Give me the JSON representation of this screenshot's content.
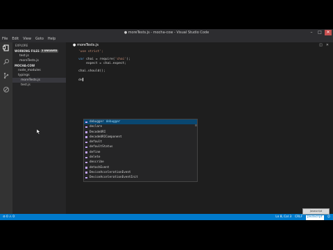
{
  "window": {
    "title": "● moreTests.js - mocha-cow - Visual Studio Code",
    "min": "–",
    "max": "□",
    "close": "✕"
  },
  "menu": [
    "File",
    "Edit",
    "View",
    "Goto",
    "Help"
  ],
  "sidebar": {
    "header": "EXPLORE",
    "working_files": {
      "label": "WORKING FILES",
      "badge": "2 UNSAVED",
      "items": [
        "test.js",
        "moreTests.js"
      ]
    },
    "project": {
      "label": "MOCHA-COW",
      "items": [
        "node_modules",
        "typings",
        "moreTests.js",
        "test.js"
      ]
    }
  },
  "editor": {
    "tab": "● moreTests.js",
    "lines": [
      {
        "parts": [
          [
            "s",
            "'use strict';"
          ]
        ]
      },
      {
        "parts": []
      },
      {
        "parts": [
          [
            "k",
            "var"
          ],
          [
            "w",
            " chai = require("
          ],
          [
            "s",
            "'chai'"
          ],
          [
            "w",
            ");"
          ]
        ]
      },
      {
        "parts": [
          [
            "w",
            "    expect = chai.expect;"
          ]
        ]
      },
      {
        "parts": []
      },
      {
        "parts": [
          [
            "w",
            "chai.should();"
          ]
        ]
      },
      {
        "parts": []
      },
      {
        "parts": [
          [
            "w",
            "de"
          ]
        ]
      }
    ]
  },
  "suggest": {
    "items": [
      "debugger",
      "declare",
      "DecodeURI",
      "decodeURIComponent",
      "default",
      "defaultStatus",
      "define",
      "delete",
      "describe",
      "detachEvent",
      "DeviceAccelerationEvent",
      "DeviceAccelerationEventInit"
    ],
    "selected_detail": "debugger"
  },
  "statusbar": {
    "left": "⊘ 0  ⚠ 0",
    "position": "Ln 8, Col 3",
    "eol": "CRLF",
    "language": "JavaScript",
    "smiley": "☺"
  },
  "tooltip": "Javascript",
  "colors": {
    "accent": "#007acc",
    "selection": "#094771"
  }
}
